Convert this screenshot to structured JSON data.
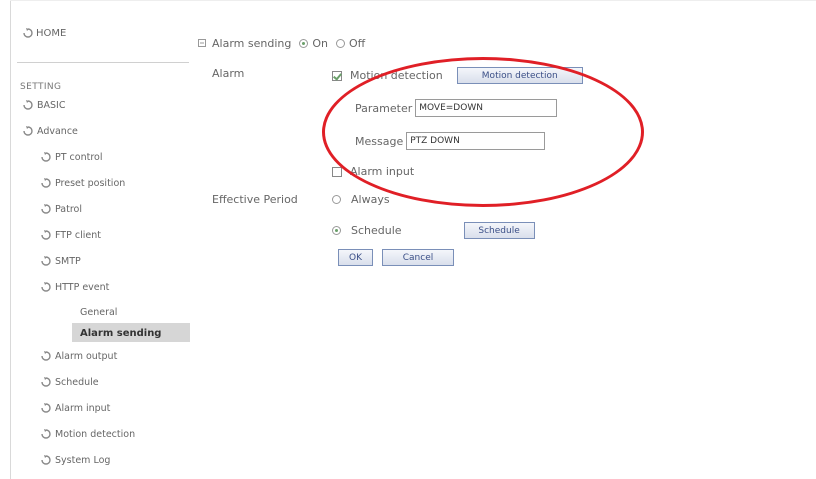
{
  "sidebar": {
    "home": "HOME",
    "setting": "SETTING",
    "items": [
      {
        "label": "BASIC",
        "icon": "arrow-refresh-icon"
      },
      {
        "label": "Advance",
        "icon": "arrow-refresh-icon"
      }
    ],
    "advance_items": [
      {
        "label": "PT control"
      },
      {
        "label": "Preset position"
      },
      {
        "label": "Patrol"
      },
      {
        "label": "FTP client"
      },
      {
        "label": "SMTP"
      },
      {
        "label": "HTTP event"
      }
    ],
    "http_event_sub": [
      {
        "label": "General"
      },
      {
        "label": "Alarm sending",
        "active": true
      }
    ],
    "more_items": [
      {
        "label": "Alarm output"
      },
      {
        "label": "Schedule"
      },
      {
        "label": "Alarm input"
      },
      {
        "label": "Motion detection"
      },
      {
        "label": "System Log"
      }
    ]
  },
  "alarm_sending": {
    "label": "Alarm sending",
    "on_label": "On",
    "off_label": "Off",
    "selected": "On"
  },
  "alarm": {
    "label": "Alarm",
    "motion_detection_label": "Motion detection",
    "motion_detection_checked": true,
    "motion_detection_button": "Motion detection",
    "parameter_label": "Parameter",
    "parameter_value": "MOVE=DOWN",
    "message_label": "Message",
    "message_value": "PTZ DOWN",
    "alarm_input_label": "Alarm input",
    "alarm_input_checked": false
  },
  "effective_period": {
    "label": "Effective Period",
    "always_label": "Always",
    "schedule_label": "Schedule",
    "selected": "Schedule",
    "schedule_button": "Schedule"
  },
  "actions": {
    "ok_label": "OK",
    "cancel_label": "Cancel"
  },
  "colors": {
    "highlight_ellipse": "#e01f26",
    "active_nav_bg": "#d6d6d6"
  }
}
